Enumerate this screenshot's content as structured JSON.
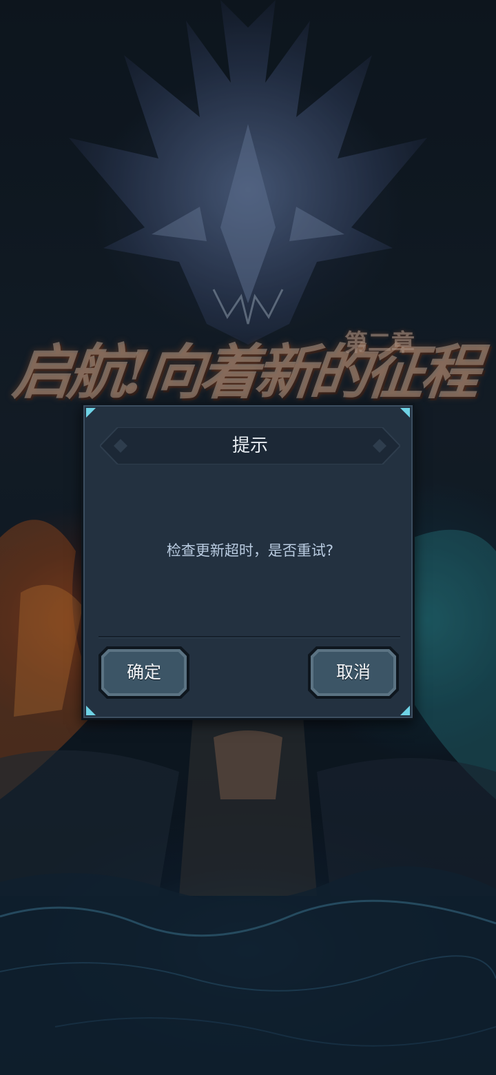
{
  "background": {
    "title_art": "启航!向着新的征程",
    "chapter_art": "第二章"
  },
  "dialog": {
    "title": "提示",
    "message": "检查更新超时，是否重试?",
    "confirm_label": "确定",
    "cancel_label": "取消"
  },
  "colors": {
    "dialog_bg": "#233140",
    "title_bar": "#1c2836",
    "button_fill": "#3c5566",
    "corner_accent": "#6fd3e6",
    "message_text": "#b9cbe0"
  }
}
